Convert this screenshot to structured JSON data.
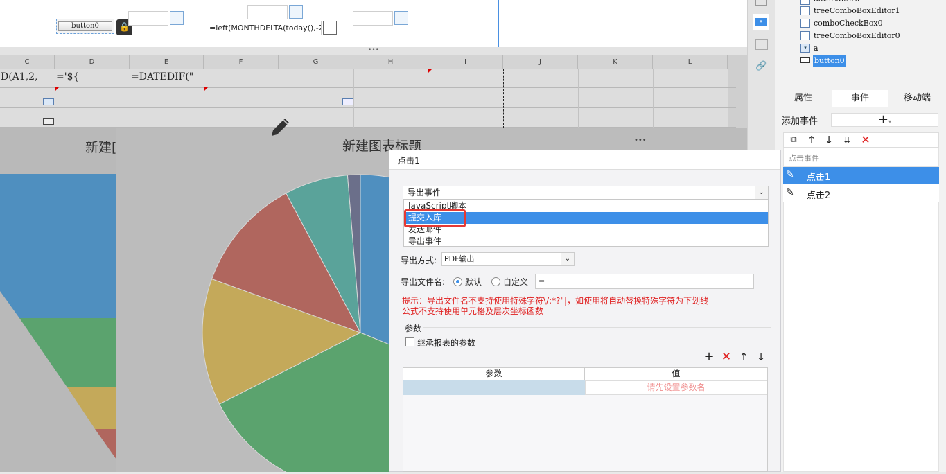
{
  "form": {
    "button_label": "button0",
    "formula_field": "=left(MONTHDELTA(today(),-2"
  },
  "grid": {
    "columns": [
      "C",
      "D",
      "E",
      "F",
      "G",
      "H",
      "I",
      "J",
      "K",
      "L"
    ],
    "cells": {
      "c1": "D(A1,2,",
      "d1": "='${",
      "e1": "=DATEDIF(\""
    }
  },
  "charts": {
    "left_title": "新建[",
    "main_title": "新建图表标题",
    "more_dots": "•••"
  },
  "chart_data": {
    "type": "pie",
    "title": "新建图表标题",
    "slices": [
      {
        "color": "#4f8fbf",
        "value": 24
      },
      {
        "color": "#5ba36e",
        "value": 28
      },
      {
        "color": "#c4a95a",
        "value": 10
      },
      {
        "color": "#b0665e",
        "value": 9
      },
      {
        "color": "#5aa39a",
        "value": 5
      },
      {
        "color": "#6b6f8a",
        "value": 1
      }
    ]
  },
  "tree": {
    "items": [
      "dateEditor0",
      "treeComboBoxEditor1",
      "comboCheckBox0",
      "treeComboBoxEditor0",
      "a",
      "button0"
    ]
  },
  "tabs": [
    "属性",
    "事件",
    "移动端"
  ],
  "events": {
    "add_label": "添加事件",
    "add_icon": "+",
    "section_label": "点击事件",
    "list": [
      "点击1",
      "点击2"
    ]
  },
  "dialog": {
    "title": "点击1",
    "select_value": "导出事件",
    "options": [
      "JavaScript脚本",
      "提交入库",
      "发送邮件",
      "导出事件"
    ],
    "export_method_label": "导出方式:",
    "export_method_value": "PDF输出",
    "filename_label": "导出文件名:",
    "radio_default": "默认",
    "radio_custom": "自定义",
    "custom_value": "=",
    "hint_line1": "提示：导出文件名不支持使用特殊字符\\/:*?\"|，如使用将自动替换特殊字符为下划线",
    "hint_line2": "公式不支持使用单元格及层次坐标函数",
    "params_section": "参数",
    "inherit_label": "继承报表的参数",
    "table_headers": [
      "参数",
      "值"
    ],
    "table_placeholder": "请先设置参数名"
  },
  "colors": {
    "accent": "#3d8fe8",
    "danger": "#e02020",
    "highlight_box": "#e53935"
  }
}
